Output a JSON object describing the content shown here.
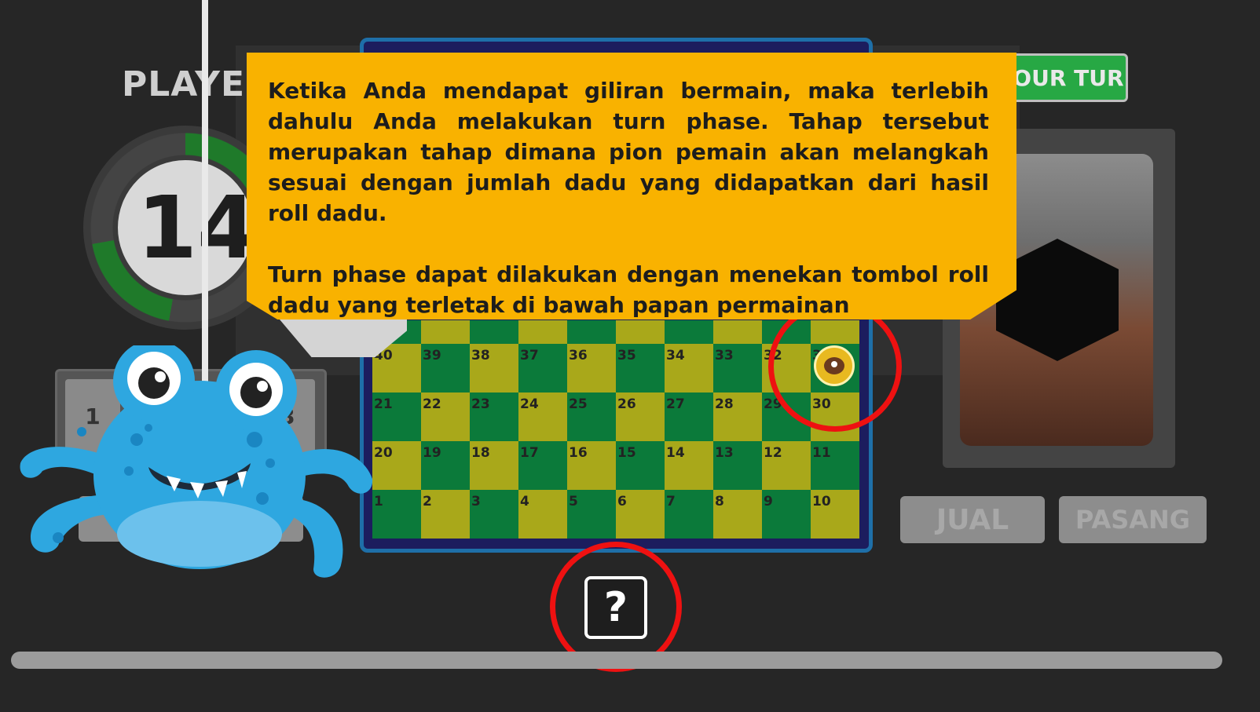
{
  "player": {
    "label": "PLAYER",
    "timer_value": "14"
  },
  "dice": [
    "1",
    "3"
  ],
  "board": {
    "rows": [
      [
        "40",
        "39",
        "38",
        "37",
        "36",
        "35",
        "34",
        "33",
        "32",
        "31"
      ],
      [
        "21",
        "22",
        "23",
        "24",
        "25",
        "26",
        "27",
        "28",
        "29",
        "30"
      ],
      [
        "20",
        "19",
        "18",
        "17",
        "16",
        "15",
        "14",
        "13",
        "12",
        "11"
      ],
      [
        "1",
        "2",
        "3",
        "4",
        "5",
        "6",
        "7",
        "8",
        "9",
        "10"
      ]
    ],
    "pawn_cell": "31"
  },
  "your_turn": {
    "label": "YOUR TURN"
  },
  "buttons": {
    "jual": "JUAL",
    "pasang": "PASANG",
    "help": "?"
  },
  "tooltip": {
    "paragraph1": "Ketika Anda mendapat giliran bermain, maka terlebih dahulu Anda melakukan turn phase. Tahap tersebut merupakan tahap dimana pion pemain akan melangkah sesuai dengan jumlah dadu yang didapatkan dari hasil roll dadu.",
    "paragraph2": "Turn phase dapat dilakukan dengan menekan tombol roll dadu yang terletak di bawah papan permainan"
  },
  "colors": {
    "board_green": "#0b7a3a",
    "board_yellow": "#a9a81a",
    "tooltip": "#f9b200",
    "highlight": "#e11111",
    "your_turn": "#27a844"
  }
}
